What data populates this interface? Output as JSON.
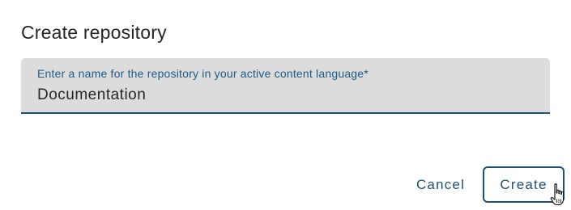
{
  "dialog": {
    "title": "Create repository"
  },
  "name_field": {
    "label": "Enter a name for the repository in your active content language*",
    "value": "Documentation"
  },
  "actions": {
    "cancel_label": "Cancel",
    "create_label": "Create"
  },
  "icons": {
    "pointer": "hand-pointer-icon"
  },
  "colors": {
    "accent": "#1f4e79",
    "field_background": "#dcdcdc",
    "label_color": "#1f5a85",
    "title_color": "#262626"
  }
}
